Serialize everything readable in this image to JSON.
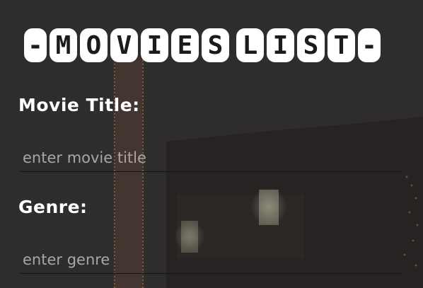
{
  "header": {
    "title_tiles": [
      "-",
      "M",
      "O",
      "V",
      "I",
      "E",
      "S",
      " ",
      "L",
      "I",
      "S",
      "T",
      "-"
    ]
  },
  "form": {
    "title_label": "Movie Title:",
    "title_placeholder": "enter movie title",
    "title_value": "",
    "genre_label": "Genre:",
    "genre_placeholder": "enter genre",
    "genre_value": ""
  },
  "colors": {
    "background": "#2f2c2c",
    "tile": "#ffffff",
    "label": "#ffffff"
  }
}
